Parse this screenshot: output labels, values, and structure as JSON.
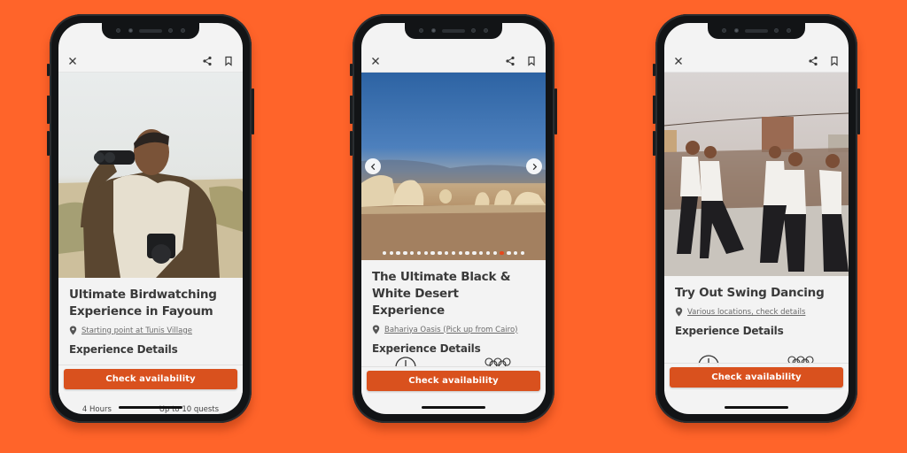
{
  "theme": {
    "background": "#FF642A",
    "cta_color": "#D9511E",
    "active_dot_color": "#E5471C"
  },
  "phones": [
    {
      "topbar": {
        "close_icon": "close-icon",
        "share_icon": "share-icon",
        "bookmark_icon": "bookmark-icon"
      },
      "photo": {
        "subject": "Man looking through binoculars with camera, wetland landscape"
      },
      "title_line1": "Ultimate Birdwatching",
      "title_line2": "Experience in Fayoum",
      "location": "Starting point at Tunis Village",
      "location_icon": "map-pin-icon",
      "section": "Experience Details",
      "details": [
        {
          "icon": "clock-icon",
          "label": "4 Hours"
        },
        {
          "icon": "group-icon",
          "label": "Up to 10 quests"
        }
      ],
      "cta": "Check availability"
    },
    {
      "topbar": {
        "close_icon": "close-icon",
        "share_icon": "share-icon",
        "bookmark_icon": "bookmark-icon"
      },
      "photo": {
        "subject": "White Desert chalk rock formations under blue sky"
      },
      "carousel": {
        "total": 21,
        "active_index": 17,
        "prev_icon": "chevron-left-icon",
        "next_icon": "chevron-right-icon"
      },
      "title_line1": "The Ultimate Black &",
      "title_line2": "White Desert Experience",
      "location": "Bahariya Oasis (Pick up from Cairo)",
      "location_icon": "map-pin-icon",
      "section": "Experience Details",
      "details": [
        {
          "icon": "clock-icon",
          "label": ""
        },
        {
          "icon": "group-icon",
          "label": ""
        }
      ],
      "cta": "Check availability"
    },
    {
      "topbar": {
        "close_icon": "close-icon",
        "share_icon": "share-icon",
        "bookmark_icon": "bookmark-icon"
      },
      "photo": {
        "subject": "People swing dancing on a Cairo rooftop"
      },
      "title_line1": "Try Out Swing Dancing",
      "title_line2": "",
      "location": "Various locations, check details",
      "location_icon": "map-pin-icon",
      "section": "Experience Details",
      "details": [
        {
          "icon": "clock-icon",
          "label": ""
        },
        {
          "icon": "group-icon",
          "label": ""
        }
      ],
      "cta": "Check availability"
    }
  ]
}
